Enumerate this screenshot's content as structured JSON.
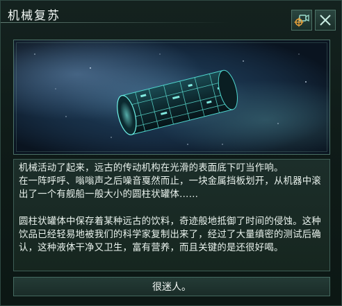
{
  "dialog": {
    "title": "机械复苏",
    "paragraphs": [
      "机械活动了起来，远古的传动机构在光滑的表面底下叮当作响。\n在一阵呼呼、嗡嗡声之后噪音戛然而止，一块金属挡板划开，从机器中滚出了一个有舰船一般大小的圆柱状罐体……",
      "圆柱状罐体中保存着某种远古的饮料，奇迹般地抵御了时间的侵蚀。这种饮品已经轻易地被我们的科学家复制出来了，经过了大量缜密的测试后确认，这种液体干净又卫生，富有营养，而且关键的是还很好喝。"
    ],
    "choice_label": "很迷人。"
  },
  "icons": {
    "header_left": "camera-target-icon",
    "header_right": "close-icon"
  },
  "colors": {
    "accent_orange": "#e8a13a",
    "accent_teal": "#5fe3d6",
    "frame": "#4c7167"
  }
}
